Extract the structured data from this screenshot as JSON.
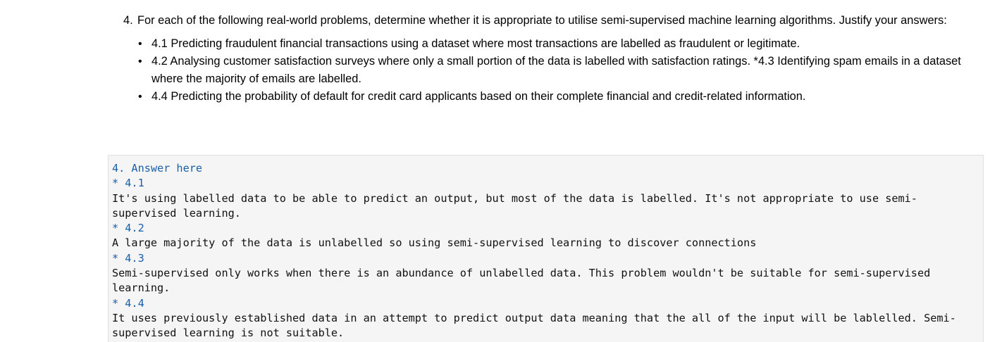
{
  "question": {
    "number": "4.",
    "text": "For each of the following real-world problems, determine whether it is appropriate to utilise semi-supervised machine learning algorithms. Justify your answers:",
    "bullets": [
      "4.1 Predicting fraudulent financial transactions using a dataset where most transactions are labelled as fraudulent or legitimate.",
      "4.2 Analysing customer satisfaction surveys where only a small portion of the data is labelled with satisfaction ratings. *4.3 Identifying spam emails in a dataset where the majority of emails are labelled.",
      "4.4 Predicting the probability of default for credit card applicants based on their complete financial and credit-related information."
    ]
  },
  "answer_cell": {
    "lines": [
      {
        "text": "4. Answer here",
        "style": "blue"
      },
      {
        "text": "* 4.1",
        "style": "blue"
      },
      {
        "text": "It's using labelled data to be able to predict an output, but most of the data is labelled. It's not appropriate to use semi-supervised learning.",
        "style": "black"
      },
      {
        "text": "* 4.2",
        "style": "blue"
      },
      {
        "text": "A large majority of the data is unlabelled so using semi-supervised learning to discover connections",
        "style": "black"
      },
      {
        "text": "* 4.3",
        "style": "blue"
      },
      {
        "text": "Semi-supervised only works when there is an abundance of unlabelled data. This problem wouldn't be suitable for semi-supervised learning.",
        "style": "black"
      },
      {
        "text": "* 4.4",
        "style": "blue"
      },
      {
        "text": "It uses previously established data in an attempt to predict output data meaning that the all of the input will be lablelled. Semi-supervised learning is not suitable.",
        "style": "black"
      }
    ]
  }
}
